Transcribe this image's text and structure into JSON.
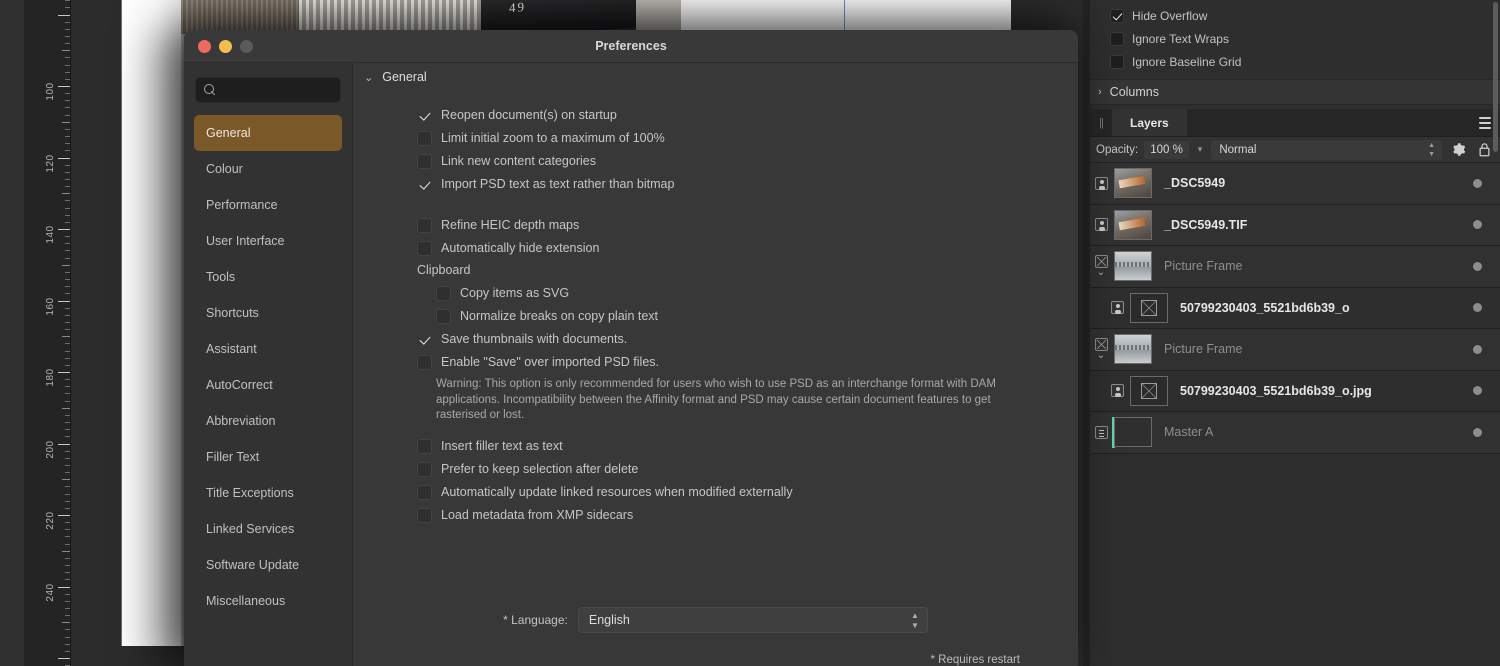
{
  "window": {
    "title": "Preferences",
    "traffic_lights": [
      "close",
      "minimize",
      "zoom"
    ]
  },
  "search": {
    "placeholder": "",
    "value": ""
  },
  "sidebar": {
    "items": [
      {
        "label": "General",
        "active": true
      },
      {
        "label": "Colour",
        "active": false
      },
      {
        "label": "Performance",
        "active": false
      },
      {
        "label": "User Interface",
        "active": false
      },
      {
        "label": "Tools",
        "active": false
      },
      {
        "label": "Shortcuts",
        "active": false
      },
      {
        "label": "Assistant",
        "active": false
      },
      {
        "label": "AutoCorrect",
        "active": false
      },
      {
        "label": "Abbreviation",
        "active": false
      },
      {
        "label": "Filler Text",
        "active": false
      },
      {
        "label": "Title Exceptions",
        "active": false
      },
      {
        "label": "Linked Services",
        "active": false
      },
      {
        "label": "Software Update",
        "active": false
      },
      {
        "label": "Miscellaneous",
        "active": false
      }
    ]
  },
  "main": {
    "header_title": "General",
    "group_clipboard_label": "Clipboard",
    "options_a": [
      {
        "label": "Reopen document(s) on startup",
        "checked": true
      },
      {
        "label": "Limit initial zoom to a maximum of 100%",
        "checked": false
      },
      {
        "label": "Link new content categories",
        "checked": false
      },
      {
        "label": "Import PSD text as text rather than bitmap",
        "checked": true
      }
    ],
    "options_b": [
      {
        "label": "Refine HEIC depth maps",
        "checked": false
      },
      {
        "label": "Automatically hide extension",
        "checked": false
      }
    ],
    "options_clipboard": [
      {
        "label": "Copy items as SVG",
        "checked": false
      },
      {
        "label": "Normalize breaks on copy plain text",
        "checked": false
      }
    ],
    "options_c": [
      {
        "label": "Save thumbnails with documents.",
        "checked": true
      },
      {
        "label": "Enable \"Save\" over imported PSD files.",
        "checked": false
      }
    ],
    "warning_text": "Warning: This option is only recommended for users who wish to use PSD as an interchange format with DAM applications. Incompatibility between the Affinity format and PSD may cause certain document features to get rasterised or lost.",
    "options_d": [
      {
        "label": "Insert filler text as text",
        "checked": false
      },
      {
        "label": "Prefer to keep selection after delete",
        "checked": false
      },
      {
        "label": "Automatically update linked resources when modified externally",
        "checked": false
      },
      {
        "label": "Load metadata from XMP sidecars",
        "checked": false
      }
    ],
    "language": {
      "label": "* Language:",
      "value": "English",
      "options": [
        "English"
      ]
    },
    "footnote": "* Requires restart"
  },
  "right_panel": {
    "text_options": [
      {
        "label": "Hide Overflow",
        "checked": true
      },
      {
        "label": "Ignore Text Wraps",
        "checked": false
      },
      {
        "label": "Ignore Baseline Grid",
        "checked": false
      }
    ],
    "section_columns": "Columns",
    "tab_label": "Layers",
    "opacity_label": "Opacity:",
    "opacity_value": "100 %",
    "blend_mode": "Normal",
    "layers": [
      {
        "name": "_DSC5949",
        "dim": false,
        "nested": false,
        "thumb": "photo-a",
        "icon": "person",
        "expandable": false,
        "marker": false
      },
      {
        "name": "_DSC5949.TIF",
        "dim": false,
        "nested": false,
        "thumb": "photo-a",
        "icon": "person",
        "expandable": false,
        "marker": false
      },
      {
        "name": "Picture Frame",
        "dim": true,
        "nested": false,
        "thumb": "photo-b",
        "icon": "xbox",
        "expandable": true,
        "marker": false
      },
      {
        "name": "50799230403_5521bd6b39_o",
        "dim": false,
        "nested": true,
        "thumb": "xthumb",
        "icon": "person",
        "expandable": false,
        "marker": false
      },
      {
        "name": "Picture Frame",
        "dim": true,
        "nested": false,
        "thumb": "photo-b",
        "icon": "xbox",
        "expandable": true,
        "marker": false
      },
      {
        "name": "50799230403_5521bd6b39_o.jpg",
        "dim": false,
        "nested": true,
        "thumb": "xthumb",
        "icon": "person",
        "expandable": false,
        "marker": false
      },
      {
        "name": "Master A",
        "dim": true,
        "nested": false,
        "thumb": "blank",
        "icon": "doc",
        "expandable": false,
        "marker": true
      }
    ]
  },
  "ruler": {
    "unit_labels": [
      "100",
      "120",
      "140",
      "160",
      "180",
      "200",
      "220",
      "240"
    ],
    "orientation": "vertical"
  },
  "colors": {
    "accent_selected": "#7b5828",
    "window_bg": "#353535",
    "panel_bg": "#2b2b2b",
    "marker_green": "#5fd6a4",
    "guide_blue": "#6d8fd0"
  }
}
